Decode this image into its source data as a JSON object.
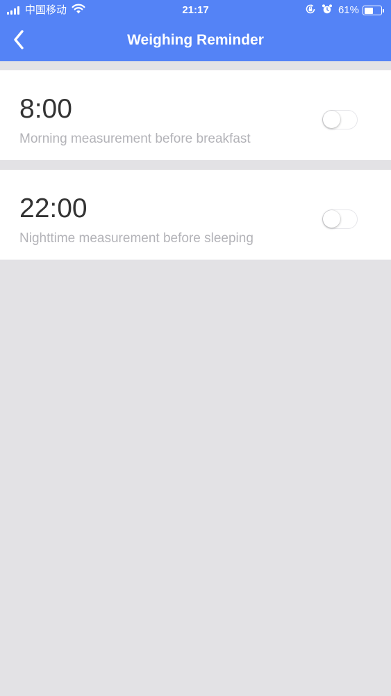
{
  "status_bar": {
    "carrier": "中国移动",
    "time": "21:17",
    "battery_percent": "61%",
    "battery_level": 0.61,
    "icons": [
      "signal-icon",
      "wifi-icon",
      "orientation-lock-icon",
      "alarm-icon",
      "battery-icon"
    ]
  },
  "navbar": {
    "title": "Weighing Reminder",
    "back_icon": "chevron-left-icon"
  },
  "reminders": [
    {
      "time": "8:00",
      "description": "Morning measurement before breakfast",
      "enabled": false
    },
    {
      "time": "22:00",
      "description": "Nighttime measurement before sleeping",
      "enabled": false
    }
  ],
  "colors": {
    "header": "#5483f6",
    "background": "#e3e2e5",
    "card": "#ffffff",
    "time_text": "#333333",
    "description_text": "#b3b3b8"
  }
}
